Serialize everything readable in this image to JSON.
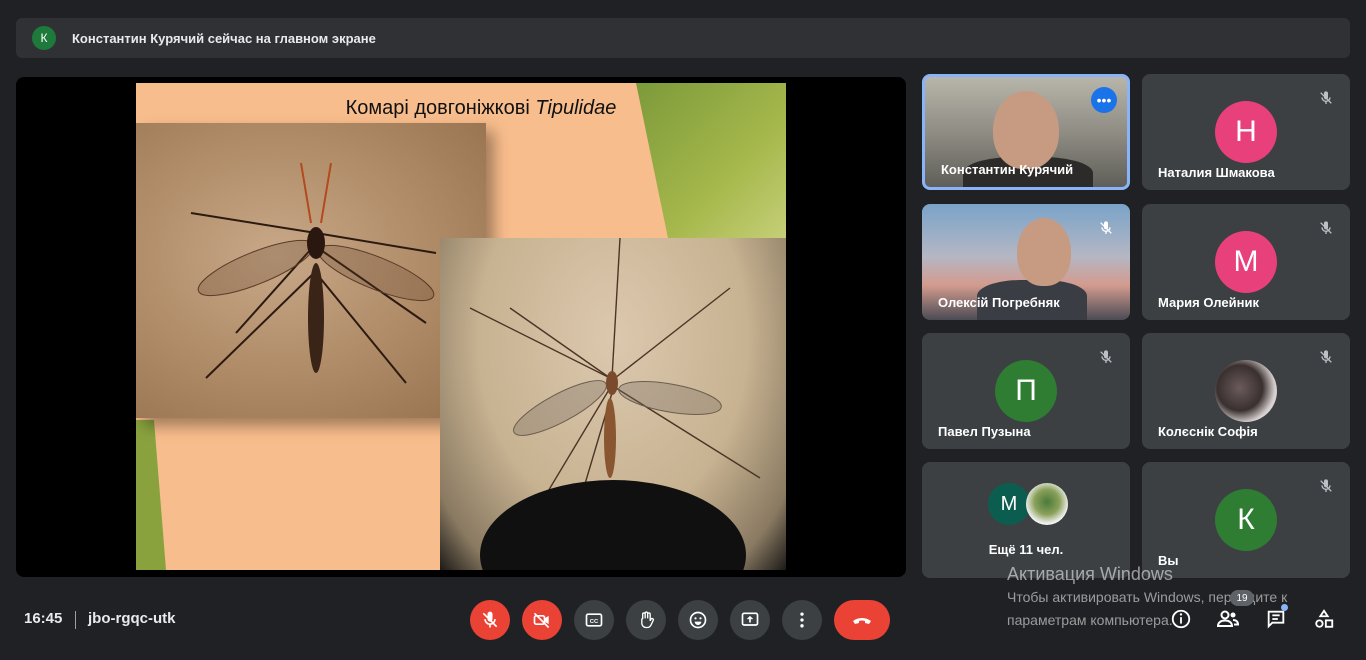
{
  "banner": {
    "avatar_letter": "К",
    "text": "Константин Курячий сейчас на главном экране"
  },
  "slide": {
    "title_prefix": "Комарі довгоніжкові ",
    "title_italic": "Tipulidae"
  },
  "participants": [
    {
      "name": "Константин Курячий",
      "video": true,
      "active": true
    },
    {
      "name": "Наталия Шмакова",
      "letter": "Н",
      "color": "#e8407a",
      "muted": true
    },
    {
      "name": "Олексій Погребняк",
      "video": true,
      "muted": true
    },
    {
      "name": "Мария Олейник",
      "letter": "М",
      "color": "#e8407a",
      "muted": true
    },
    {
      "name": "Павел Пузына",
      "letter": "П",
      "color": "#2e7d32",
      "muted": true
    },
    {
      "name": "Колєснік Софія",
      "photo": true,
      "muted": true
    },
    {
      "more_label": "Ещё 11 чел.",
      "letter": "М",
      "color": "#0b5e4f"
    },
    {
      "name": "Вы",
      "letter": "К",
      "color": "#2e7d32",
      "muted": true
    }
  ],
  "bottom": {
    "time": "16:45",
    "meeting_code": "jbo-rgqc-utk",
    "participants_count": "19"
  },
  "watermark": {
    "line1": "Активация Windows",
    "line2": "Чтобы активировать Windows, перейдите к",
    "line3": "параметрам компьютера."
  },
  "colors": {
    "background": "#202124",
    "tile": "#3c4043",
    "danger": "#ea4335",
    "accent": "#8ab4f8"
  }
}
